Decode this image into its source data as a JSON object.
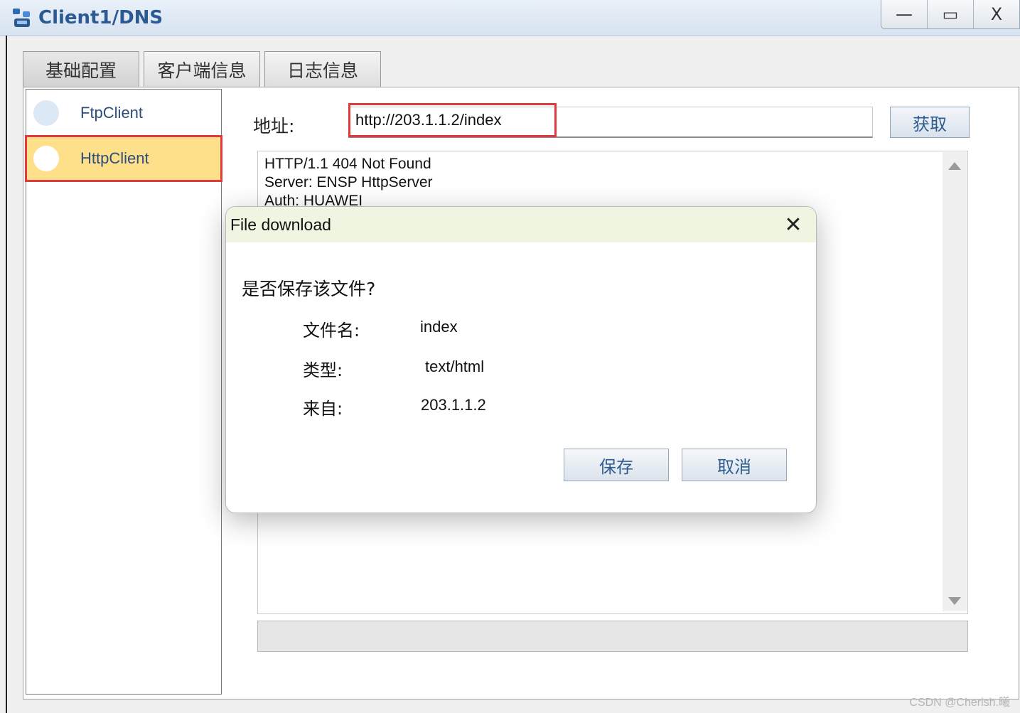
{
  "window": {
    "title": "Client1/DNS",
    "minimize": "—",
    "maximize": "▭",
    "close": "X"
  },
  "tabs": [
    "基础配置",
    "客户端信息",
    "日志信息"
  ],
  "sidebar": {
    "items": [
      "FtpClient",
      "HttpClient"
    ],
    "selected": "HttpClient"
  },
  "address": {
    "label": "地址:",
    "value": "http://203.1.1.2/index"
  },
  "fetch_button": "获取",
  "output": {
    "lines": [
      "HTTP/1.1 404 Not Found",
      "Server: ENSP HttpServer",
      "Auth: HUAWEI"
    ]
  },
  "dialog": {
    "title": "File download",
    "close": "✕",
    "question": "是否保存该文件?",
    "rows": [
      {
        "label": "文件名:",
        "value": "index"
      },
      {
        "label": "类型:",
        "value": "text/html"
      },
      {
        "label": "来自:",
        "value": "203.1.1.2"
      }
    ],
    "save": "保存",
    "cancel": "取消"
  },
  "watermark": "CSDN @Cherish.曦",
  "colors": {
    "selected_bg": "#ffe08a",
    "highlight_border": "#e0393e",
    "dialog_header": "#eef6e2",
    "title_blue": "#2b5a93"
  }
}
